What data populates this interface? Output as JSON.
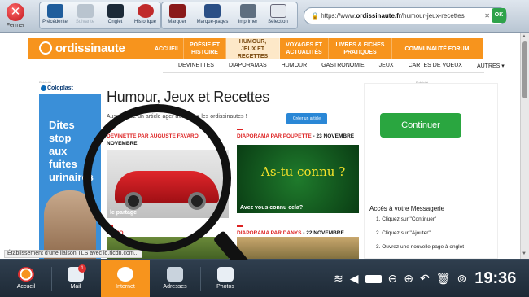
{
  "toolbar": {
    "close_label": "Fermer",
    "buttons": [
      {
        "label": "Précédente"
      },
      {
        "label": "Suivante"
      },
      {
        "label": "Onglet"
      },
      {
        "label": "Historique"
      },
      {
        "label": "Marquer"
      },
      {
        "label": "Marque-pages"
      },
      {
        "label": "Imprimer"
      },
      {
        "label": "Sélection"
      }
    ],
    "url_scheme": "https://www.",
    "url_host": "ordissinaute.fr",
    "url_path": "/humour-jeux-recettes",
    "ok_label": "OK"
  },
  "site": {
    "logo": "ordissinaute",
    "nav": [
      {
        "label": "ACCUEIL"
      },
      {
        "label": "POÉSIE ET HISTOIRE"
      },
      {
        "label": "HUMOUR, JEUX ET RECETTES"
      },
      {
        "label": "VOYAGES ET ACTUALITÉS"
      },
      {
        "label": "LIVRES & FICHES PRATIQUES"
      },
      {
        "label": "COMMUNAUTÉ FORUM"
      }
    ],
    "subnav": [
      "DEVINETTES",
      "DIAPORAMAS",
      "HUMOUR",
      "GASTRONOMIE",
      "JEUX",
      "CARTES DE VOEUX",
      "AUTRES ▾"
    ],
    "pub_label": "Publicité"
  },
  "ad_left": {
    "brand": "Coloplast",
    "text_lines": [
      "Dites",
      "stop",
      "aux",
      "fuites",
      "urinaires"
    ]
  },
  "main": {
    "title": "Humour, Jeux et Recettes",
    "intro": "Aussi créez un article      ager avec tous les ordissinautes !",
    "create_button": "Créer un article",
    "cards": [
      {
        "category": "DEVINETTE PAR AUGUSTE FAVARO",
        "date": "NOVEMBRE",
        "caption": "le partage"
      },
      {
        "category": "DIAPORAMA PAR POUPETTE",
        "date": "- 23 NOVEMBRE",
        "caption": "Avez vous connu cela?",
        "image_text": "As-tu connu ?"
      },
      {
        "category": "DIAPO",
        "date": "",
        "caption": ""
      },
      {
        "category": "DIAPORAMA PAR DANYS",
        "date": "- 22 NOVEMBRE",
        "caption": ""
      }
    ]
  },
  "ad_right": {
    "button": "Continuer",
    "heading": "Accès à votre Messagerie",
    "steps": [
      "1. Cliquez sur \"Continuer\"",
      "2. Cliquez sur \"Ajouter\"",
      "3. Ouvrez une nouvelle page à onglet"
    ]
  },
  "status_text": "Établissement d'une liaison TLS avec id.rlcdn.com...",
  "dock": {
    "items": [
      {
        "label": "Accueil"
      },
      {
        "label": "Mail",
        "badge": "1"
      },
      {
        "label": "Internet"
      },
      {
        "label": "Adresses"
      },
      {
        "label": "Photos"
      }
    ],
    "clock": "19:36"
  },
  "colors": {
    "brand_orange": "#f7941d",
    "accent_red": "#d22222",
    "continue_green": "#2aa640"
  }
}
